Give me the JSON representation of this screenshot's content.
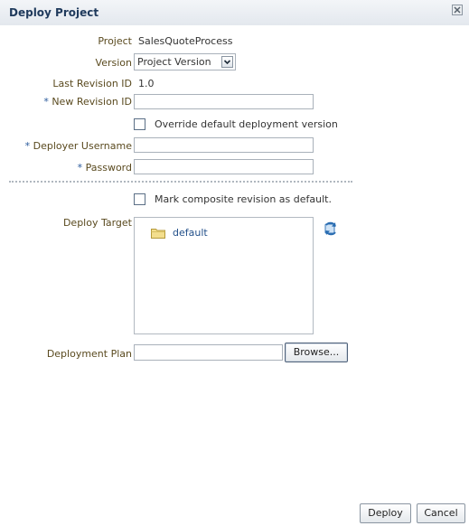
{
  "dialog": {
    "title": "Deploy Project",
    "close_icon": "close-icon"
  },
  "form": {
    "project_label": "Project",
    "project_value": "SalesQuoteProcess",
    "version_label": "Version",
    "version_selected": "Project Version",
    "last_revision_label": "Last Revision ID",
    "last_revision_value": "1.0",
    "required_marker": "*",
    "new_revision_label": "New Revision ID",
    "new_revision_value": "",
    "override_label": "Override default deployment version",
    "override_checked": false,
    "deployer_username_label": "Deployer Username",
    "deployer_username_value": "",
    "password_label": "Password",
    "password_value": "",
    "mark_default_label": "Mark composite revision as default.",
    "mark_default_checked": false,
    "deploy_target_label": "Deploy Target",
    "deploy_target_items": [
      "default"
    ],
    "deployment_plan_label": "Deployment Plan",
    "deployment_plan_value": "",
    "browse_label": "Browse..."
  },
  "footer": {
    "deploy_label": "Deploy",
    "cancel_label": "Cancel"
  },
  "icons": {
    "folder": "folder-icon",
    "refresh": "refresh-icon",
    "dropdown": "chevron-down-icon"
  },
  "colors": {
    "label": "#5a4a1f",
    "title": "#1f3a5c",
    "link": "#23508a"
  }
}
